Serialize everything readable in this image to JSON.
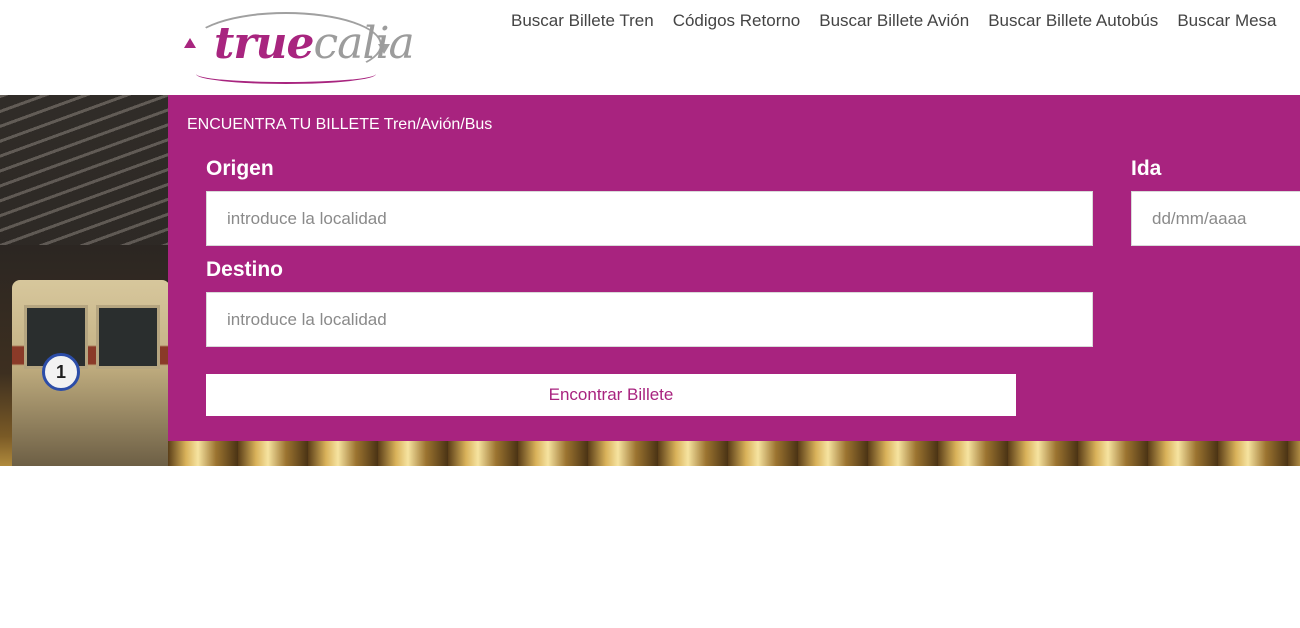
{
  "header": {
    "logo": {
      "part1": "true",
      "part2": "calia"
    },
    "nav": [
      "Buscar Billete Tren",
      "Códigos Retorno",
      "Buscar Billete Avión",
      "Buscar Billete Autobús",
      "Buscar Mesa"
    ]
  },
  "hero": {
    "platform_sign": "1"
  },
  "search": {
    "title": "ENCUENTRA TU BILLETE Tren/Avión/Bus",
    "origin": {
      "label": "Origen",
      "placeholder": "introduce la localidad"
    },
    "destination": {
      "label": "Destino",
      "placeholder": "introduce la localidad"
    },
    "departure": {
      "label": "Ida",
      "placeholder": "dd/mm/aaaa"
    },
    "submit_label": "Encontrar Billete"
  },
  "colors": {
    "brand": "#a8237f",
    "logo_gray": "#9c9c9c",
    "nav_text": "#444444"
  }
}
